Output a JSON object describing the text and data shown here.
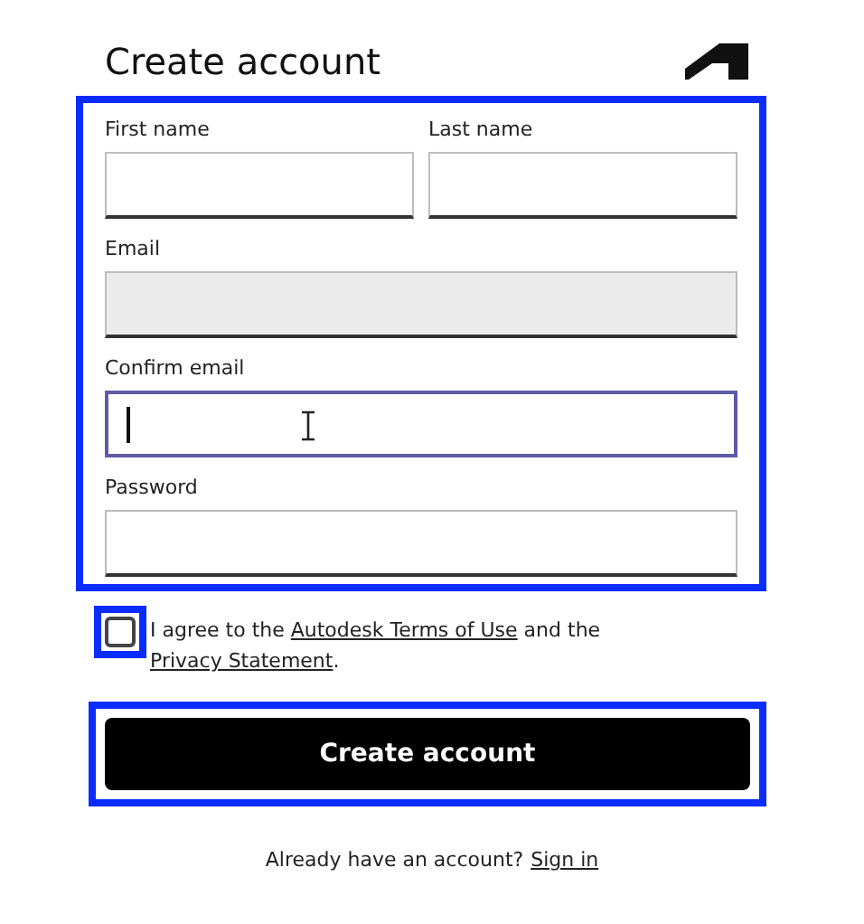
{
  "header": {
    "title": "Create account"
  },
  "form": {
    "highlighted": true,
    "rows": [
      {
        "fields": [
          {
            "label": "First name",
            "focused": false,
            "disabled": false
          },
          {
            "label": "Last name",
            "focused": false,
            "disabled": false
          }
        ]
      },
      {
        "fields": [
          {
            "label": "Email",
            "focused": false,
            "disabled": true
          }
        ]
      },
      {
        "fields": [
          {
            "label": "Confirm email",
            "focused": true,
            "disabled": false
          }
        ]
      },
      {
        "fields": [
          {
            "label": "Password",
            "focused": false,
            "disabled": false
          }
        ]
      }
    ]
  },
  "agreement": {
    "checked": false,
    "highlighted": true,
    "parts": [
      {
        "kind": "text",
        "text": "I agree to the "
      },
      {
        "kind": "link",
        "text": "Autodesk Terms of Use"
      },
      {
        "kind": "text",
        "text": " and the "
      },
      {
        "kind": "link",
        "text": "Privacy Statement"
      },
      {
        "kind": "text",
        "text": "."
      }
    ]
  },
  "submit": {
    "label": "Create account",
    "highlighted": true
  },
  "footer": {
    "text": "Already have an account?",
    "link": "Sign in"
  }
}
